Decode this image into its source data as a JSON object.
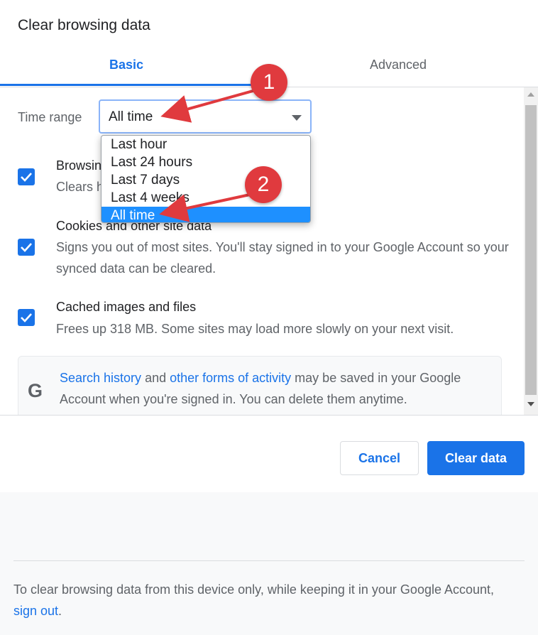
{
  "dialog": {
    "title": "Clear browsing data"
  },
  "tabs": [
    {
      "label": "Basic",
      "active": true
    },
    {
      "label": "Advanced",
      "active": false
    }
  ],
  "time_range": {
    "label": "Time range",
    "value": "All time",
    "options": [
      "Last hour",
      "Last 24 hours",
      "Last 7 days",
      "Last 4 weeks",
      "All time"
    ],
    "selected_option": "All time"
  },
  "items": [
    {
      "title": "Browsing history",
      "desc": "Clears history from all synced devices",
      "checked": true
    },
    {
      "title": "Cookies and other site data",
      "desc": "Signs you out of most sites. You'll stay signed in to your Google Account so your synced data can be cleared.",
      "checked": true
    },
    {
      "title": "Cached images and files",
      "desc": "Frees up 318 MB. Some sites may load more slowly on your next visit.",
      "checked": true
    }
  ],
  "google_notice": {
    "icon": "G",
    "link1": "Search history",
    "text1": " and ",
    "link2": "other forms of activity",
    "text2": " may be saved in your Google Account when you're signed in. You can delete them anytime."
  },
  "buttons": {
    "cancel": "Cancel",
    "clear": "Clear data"
  },
  "footer": {
    "text": "To clear browsing data from this device only, while keeping it in your Google Account, ",
    "link": "sign out",
    "end": "."
  },
  "annotations": {
    "marker1": "1",
    "marker2": "2"
  },
  "colors": {
    "accent": "#1a73e8",
    "marker": "#e03a3e",
    "highlight": "#1e90ff"
  }
}
